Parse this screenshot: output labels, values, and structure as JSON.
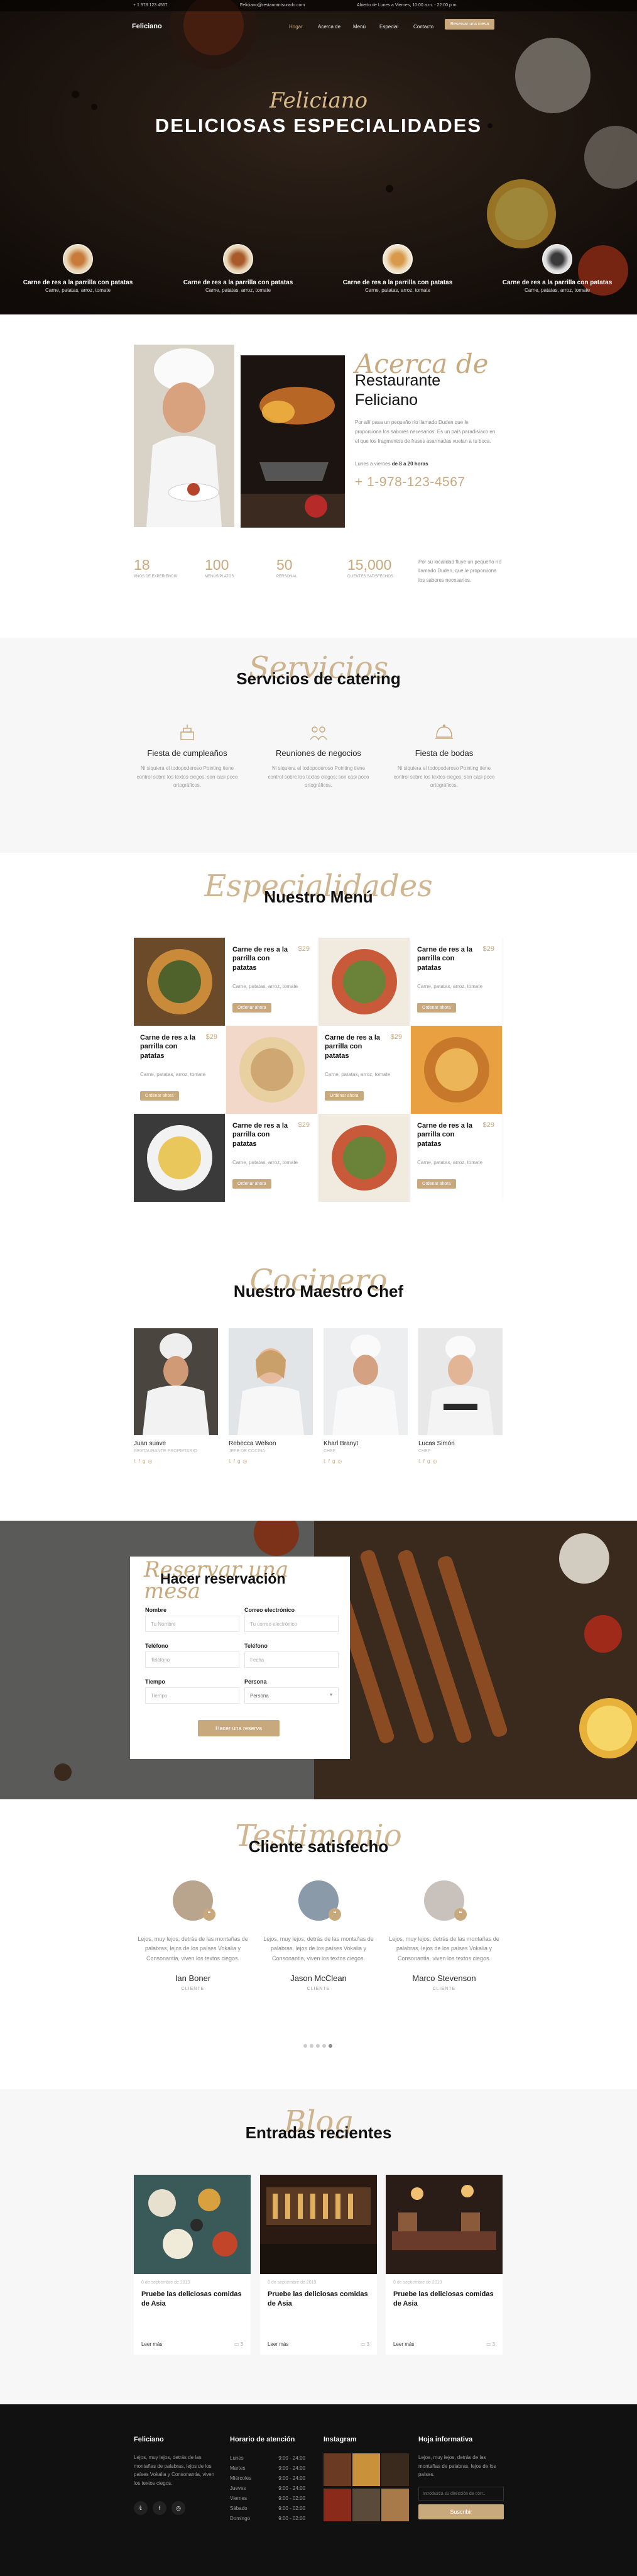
{
  "colors": {
    "accent": "#c8a97e",
    "dark": "#111111",
    "light_bg": "#f7f7f7"
  },
  "topbar": {
    "phone": "+ 1 978 123 4567",
    "email": "Feliciano@restaurantsurado.com",
    "hours": "Abierto de Lunes a Viernes, 10:00 a.m. - 22:00 p.m."
  },
  "nav": {
    "brand": "Feliciano",
    "links": [
      "Hogar",
      "Acerca de",
      "Menú",
      "Especial",
      "Contacto"
    ],
    "cta": "Reservar una mesa"
  },
  "hero": {
    "script": "Feliciano",
    "title": "DELICIOSAS ESPECIALIDADES",
    "items": [
      {
        "title": "Carne de res a la parrilla con patatas",
        "desc": "Carne, patatas, arroz, tomate"
      },
      {
        "title": "Carne de res a la parrilla con patatas",
        "desc": "Carne, patatas, arroz, tomate"
      },
      {
        "title": "Carne de res a la parrilla con patatas",
        "desc": "Carne, patatas, arroz, tomate"
      },
      {
        "title": "Carne de res a la parrilla con patatas",
        "desc": "Carne, patatas, arroz, tomate"
      }
    ]
  },
  "about": {
    "script": "Acerca de",
    "title_line1": "Restaurante",
    "title_line2": "Feliciano",
    "text": "Por allí pasa un pequeño río llamado Duden que le proporciona los sabores necesarios. Es un país paradisíaco en el que los fragmentos de frases asarmadas vuelan a tu boca.",
    "hours_prefix": "Lunes a viernes",
    "hours_bold": "de 8 a 20 horas",
    "phone": "+ 1-978-123-4567"
  },
  "stats": [
    {
      "value": "18",
      "label": "AÑOS DE EXPERIENCIA"
    },
    {
      "value": "100",
      "label": "MENÚS/PLATOS"
    },
    {
      "value": "50",
      "label": "PERSONAL"
    },
    {
      "value": "15,000",
      "label": "CLIENTES SATISFECHOS"
    }
  ],
  "stats_text": "Por su localidad fluye un pequeño río llamado Duden, que le proporciona los sabores necesarios.",
  "catering": {
    "script": "Servicios",
    "title": "Servicios de catering",
    "items": [
      {
        "title": "Fiesta de cumpleaños",
        "text": "Ni siquiera el todopoderoso Pointing tiene control sobre los textos ciegos; son casi poco ortográficos."
      },
      {
        "title": "Reuniones de negocios",
        "text": "Ni siquiera el todopoderoso Pointing tiene control sobre los textos ciegos; son casi poco ortográficos."
      },
      {
        "title": "Fiesta de bodas",
        "text": "Ni siquiera el todopoderoso Pointing tiene control sobre los textos ciegos; son casi poco ortográficos."
      }
    ]
  },
  "menu": {
    "script": "Especialidades",
    "title": "Nuestro Menú",
    "item": {
      "title": "Carne de res a la parrilla con patatas",
      "price": "$29",
      "desc": "Carne, patatas, arroz, tomate",
      "button": "Ordenar ahora"
    }
  },
  "chefs": {
    "script": "Cocinero",
    "title": "Nuestro Maestro Chef",
    "list": [
      {
        "name": "Juan suave",
        "role": "RESTAURANTE PROPIETARIO"
      },
      {
        "name": "Rebecca Welson",
        "role": "JEFE DE COCINA"
      },
      {
        "name": "Kharl Branyt",
        "role": "CHEF"
      },
      {
        "name": "Lucas Simón",
        "role": "CHEF"
      }
    ]
  },
  "reservation": {
    "script": "Reservar una mesa",
    "title": "Hacer reservación",
    "fields": [
      {
        "label": "Nombre",
        "placeholder": "Tu Nombre"
      },
      {
        "label": "Correo electrónico",
        "placeholder": "Tu correo electrónico"
      },
      {
        "label": "Teléfono",
        "placeholder": "Teléfono"
      },
      {
        "label": "Teléfono",
        "placeholder": "Fecha"
      },
      {
        "label": "Tiempo",
        "placeholder": "Tiempo"
      },
      {
        "label": "Persona",
        "placeholder": "Persona"
      }
    ],
    "button": "Hacer una reserva"
  },
  "testimonials": {
    "script": "Testimonio",
    "title": "Cliente satisfecho",
    "list": [
      {
        "quote": "Lejos, muy lejos, detrás de las montañas de palabras, lejos de los países Vokalia y Consonantia, viven los textos ciegos.",
        "name": "Ian Boner",
        "role": "CLIENTE"
      },
      {
        "quote": "Lejos, muy lejos, detrás de las montañas de palabras, lejos de los países Vokalia y Consonantia, viven los textos ciegos.",
        "name": "Jason McClean",
        "role": "CLIENTE"
      },
      {
        "quote": "Lejos, muy lejos, detrás de las montañas de palabras, lejos de los países Vokalia y Consonantia, viven los textos ciegos.",
        "name": "Marco Stevenson",
        "role": "CLIENTE"
      }
    ]
  },
  "blog": {
    "script": "Blog",
    "title": "Entradas recientes",
    "posts": [
      {
        "date": "8 de septiembre de 2019",
        "title": "Pruebe las deliciosas comidas de Asia",
        "link": "Leer más",
        "comments": "3"
      },
      {
        "date": "8 de septiembre de 2019",
        "title": "Pruebe las deliciosas comidas de Asia",
        "link": "Leer más",
        "comments": "3"
      },
      {
        "date": "8 de septiembre de 2019",
        "title": "Pruebe las deliciosas comidas de Asia",
        "link": "Leer más",
        "comments": "3"
      }
    ]
  },
  "footer": {
    "brand": "Feliciano",
    "about": "Lejos, muy lejos, detrás de las montañas de palabras, lejos de los países Vokalia y Consonantia, viven los textos ciegos.",
    "hours_title": "Horario de atención",
    "hours": [
      {
        "day": "Lunes",
        "time": "9:00 - 24:00"
      },
      {
        "day": "Martes",
        "time": "9:00 - 24:00"
      },
      {
        "day": "Miércoles",
        "time": "9:00 - 24:00"
      },
      {
        "day": "Jueves",
        "time": "9:00 - 24:00"
      },
      {
        "day": "Viernes",
        "time": "9:00 - 02:00"
      },
      {
        "day": "Sábado",
        "time": "9:00 - 02:00"
      },
      {
        "day": "Domingo",
        "time": "9:00 - 02:00"
      }
    ],
    "instagram_title": "Instagram",
    "newsletter_title": "Hoja informativa",
    "newsletter_text": "Lejos, muy lejos, detrás de las montañas de palabras, lejos de los países.",
    "newsletter_placeholder": "Introduzca su dirección de corr...",
    "newsletter_button": "Suscribir"
  }
}
